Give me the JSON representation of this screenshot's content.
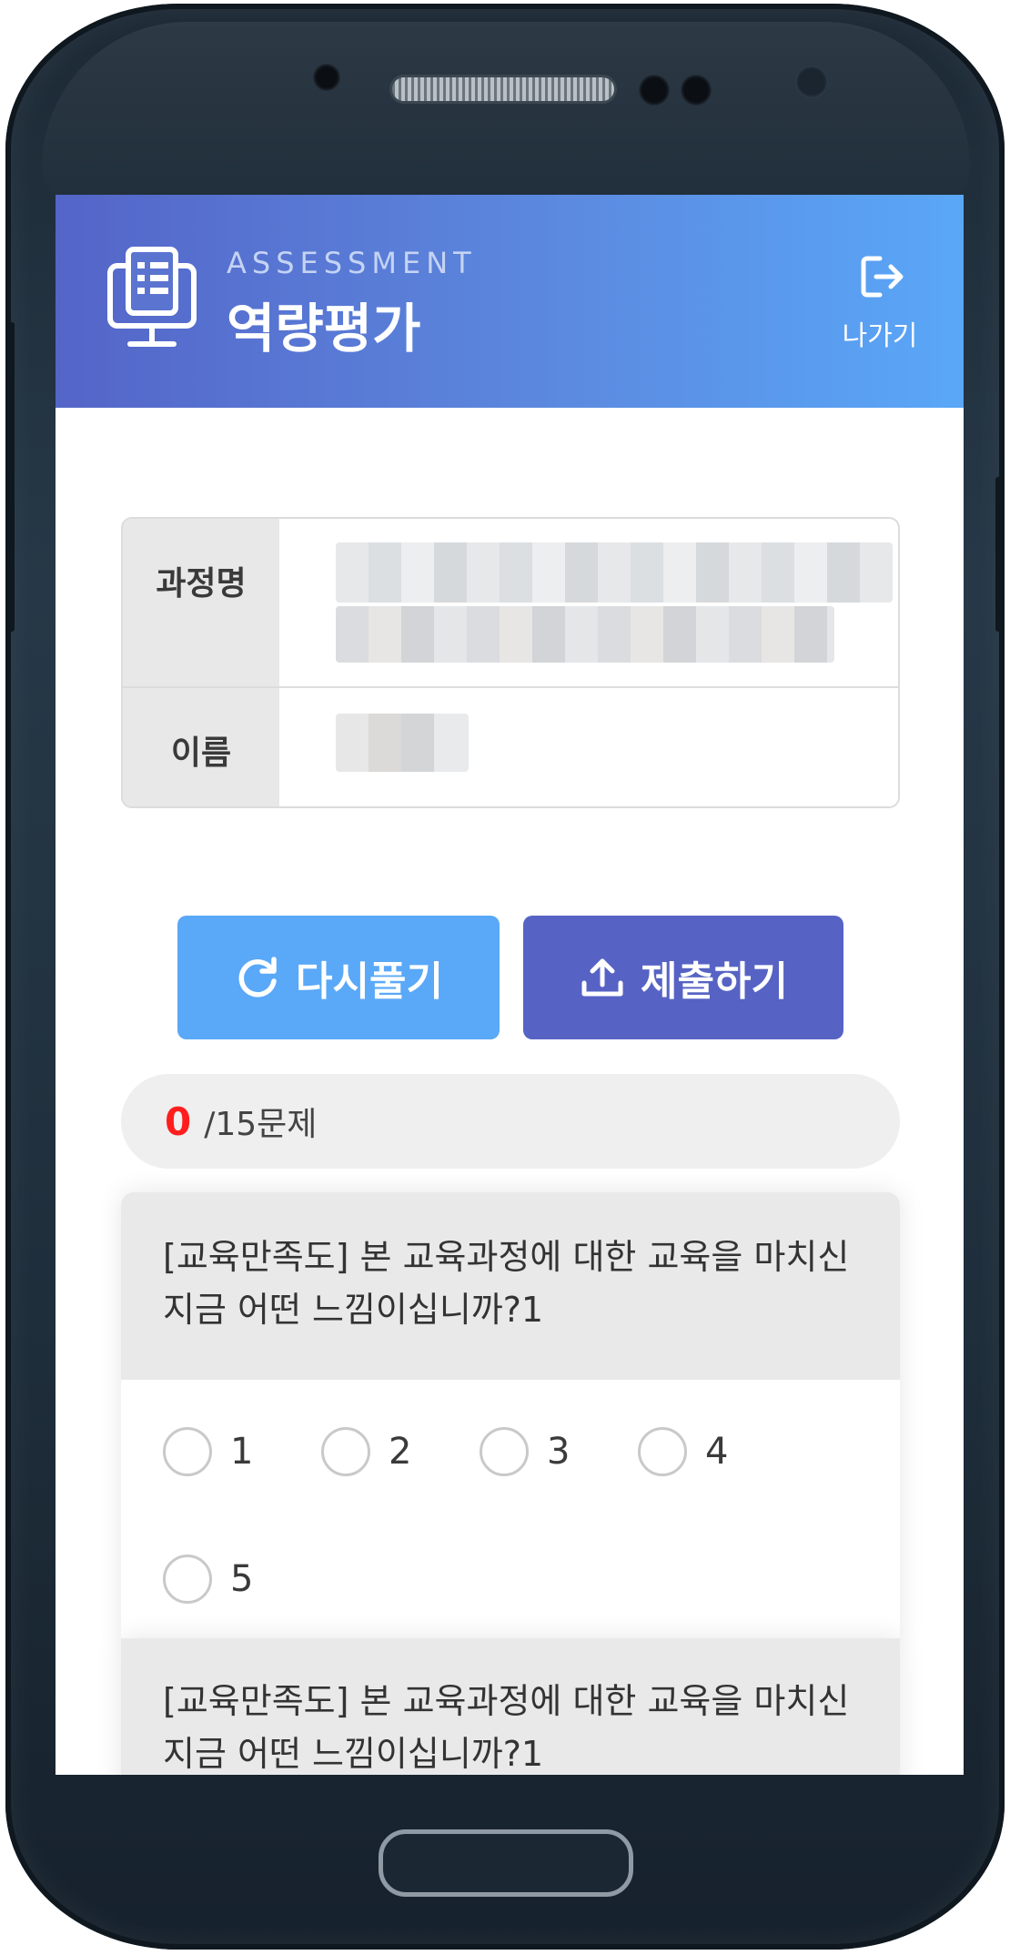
{
  "header": {
    "subtitle": "ASSESSMENT",
    "title": "역량평가",
    "exit_label": "나가기",
    "gradient_start": "#5465c8",
    "gradient_end": "#5aa7f8"
  },
  "info": {
    "course_label": "과정명",
    "name_label": "이름"
  },
  "actions": {
    "retry_label": "다시풀기",
    "submit_label": "제출하기",
    "retry_color": "#5aa8f8",
    "submit_color": "#5663c4"
  },
  "progress": {
    "answered": "0",
    "total_label": "/15문제",
    "answered_color": "#ff1e1e"
  },
  "questions": [
    {
      "text": "[교육만족도] 본 교육과정에 대한 교육을 마치신 지금 어떤 느낌이십니까?1",
      "options": [
        "1",
        "2",
        "3",
        "4",
        "5"
      ]
    },
    {
      "text": "[교육만족도] 본 교육과정에 대한 교육을 마치신 지금 어떤 느낌이십니까?1"
    }
  ],
  "icons": {
    "header": "survey-monitor-icon",
    "exit": "logout-icon",
    "retry": "refresh-icon",
    "submit": "upload-icon"
  }
}
